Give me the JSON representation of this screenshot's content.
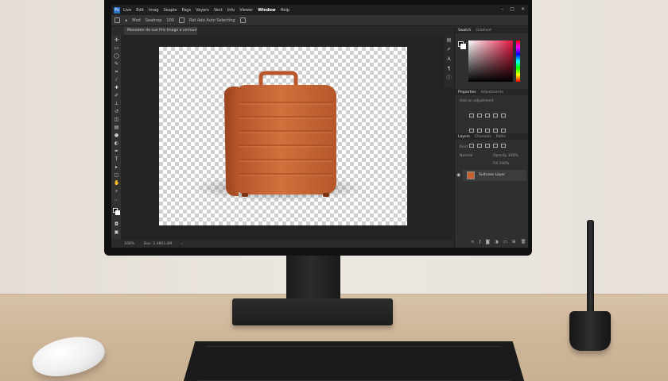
{
  "menubar": {
    "logo": "Ps",
    "items": [
      "Live",
      "Edit",
      "Imag",
      "Seaple",
      "Pags",
      "Vayers",
      "Vect",
      "Info",
      "Viewer",
      "Window",
      "Help"
    ],
    "window_controls": [
      "–",
      "▢",
      "✕"
    ]
  },
  "options_bar": {
    "items": [
      "∎",
      "Mod",
      "Seatnop",
      "100",
      "Rat Add Auto Selecting"
    ]
  },
  "document": {
    "tab_label": "Maneater de sue Pris Image a verinum ▾"
  },
  "status_bar": {
    "zoom": "100%",
    "info": "Doc: 2.4M/2.4M"
  },
  "panels": {
    "color_tabs": [
      "Swatch",
      "Gradient"
    ],
    "properties_tabs": [
      "Properties",
      "Adjustments"
    ],
    "adjustments_label": "Add an adjustment",
    "layers_tabs": [
      "Layers",
      "Channels",
      "Paths"
    ],
    "layer_kind": "Kind",
    "layer_blend": "Normal",
    "layer_opacity": "Opacity 100%",
    "layer_fill": "Fill 100%",
    "layer_name": "Suitcase Layer"
  },
  "icons": {
    "toolbar": [
      "move-icon",
      "marquee-icon",
      "lasso-icon",
      "quick-select-icon",
      "crop-icon",
      "eyedropper-icon",
      "healing-icon",
      "brush-icon",
      "stamp-icon",
      "history-brush-icon",
      "eraser-icon",
      "gradient-icon",
      "blur-icon",
      "dodge-icon",
      "pen-icon",
      "type-icon",
      "path-select-icon",
      "shape-icon",
      "hand-icon",
      "zoom-icon"
    ],
    "layer_actions": [
      "link-icon",
      "fx-icon",
      "mask-icon",
      "adjustment-icon",
      "folder-icon",
      "new-layer-icon",
      "trash-icon"
    ]
  },
  "scene": {
    "subject": "orange suitcase",
    "canvas_background": "transparent checkerboard"
  },
  "colors": {
    "suitcase": "#c7612f",
    "suitcase_dark": "#9e4620",
    "ui_dark": "#2b2b2b",
    "accent_hue_red": "#e3163f"
  }
}
